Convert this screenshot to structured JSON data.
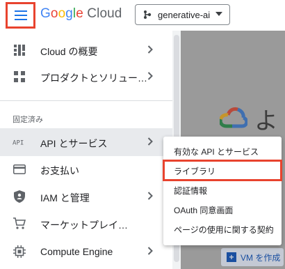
{
  "header": {
    "logo_google": [
      "G",
      "o",
      "o",
      "g",
      "l",
      "e"
    ],
    "logo_cloud": "Cloud",
    "project": "generative-ai"
  },
  "sidebar": {
    "items_top": [
      {
        "label": "Cloud の概要",
        "icon": "dashboard-icon"
      },
      {
        "label": "プロダクトとソリュー…",
        "icon": "grid-icon"
      }
    ],
    "section_title": "固定済み",
    "items_pinned": [
      {
        "label": "API とサービス",
        "icon": "api-icon",
        "active": true
      },
      {
        "label": "お支払い",
        "icon": "credit-card-icon"
      },
      {
        "label": "IAM と管理",
        "icon": "shield-icon"
      },
      {
        "label": "マーケットプレイ…",
        "icon": "cart-icon"
      },
      {
        "label": "Compute Engine",
        "icon": "chip-icon"
      }
    ]
  },
  "submenu": {
    "items": [
      {
        "label": "有効な API とサービス",
        "highlight": false
      },
      {
        "label": "ライブラリ",
        "highlight": true
      },
      {
        "label": "認証情報",
        "highlight": false
      },
      {
        "label": "OAuth 同意画面",
        "highlight": false
      },
      {
        "label": "ページの使用に関する契約",
        "highlight": false
      }
    ]
  },
  "main": {
    "welcome": "よう",
    "vm_button": "VM を作成"
  },
  "colors": {
    "highlight_border": "#e8432e",
    "menu_icon": "#1a73e8",
    "active_bg": "#e8eaed"
  }
}
